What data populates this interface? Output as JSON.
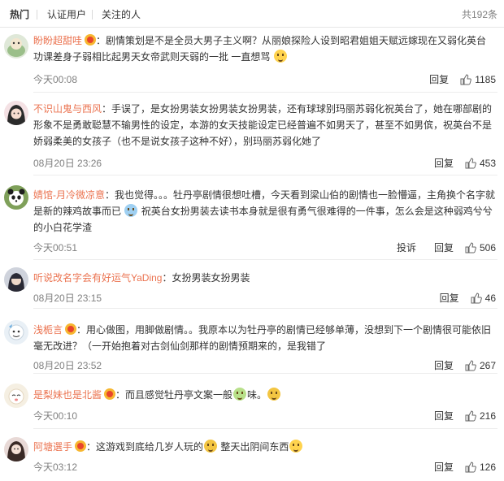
{
  "tabs": {
    "hot": "热门",
    "verified": "认证用户",
    "following": "关注的人"
  },
  "total": "共192条",
  "labels": {
    "reply": "回复",
    "report": "投诉"
  },
  "comments": [
    {
      "user": "盼盼超甜哇",
      "text1": "：剧情策划是不是全员大男子主义啊？从丽娘探险人设到昭君姐姐天赋远嫁现在又弱化英台功课差身子弱相比起男天女帝武则天弱的一批 一直想骂",
      "text2": "",
      "time": "今天00:08",
      "likes": "1185"
    },
    {
      "user": "不识山鬼与西风",
      "text1": "：手误了，是女扮男装女扮男装女扮男装，还有球球别玛丽苏弱化祝英台了，她在哪部剧的形象不是勇敢聪慧不输男性的设定，本游的女天技能设定已经普遍不如男天了，甚至不如男傧，祝英台不是娇弱柔美的女孩子（也不是说女孩子这种不好），别玛丽苏弱化她了",
      "text2": "",
      "time": "08月20日 23:26",
      "likes": "453"
    },
    {
      "user": "婧馆-月冷微凉意",
      "text1": "：我也觉得。。。牡丹亭剧情很想吐槽，今天看到梁山伯的剧情也一脸懵逼，主角换个名字就是新的辣鸡故事而已",
      "text2": "祝英台女扮男装去读书本身就是很有勇气很难得的一件事，怎么会是这种弱鸡兮兮的小白花学渣",
      "time": "今天00:51",
      "likes": "506"
    },
    {
      "user": "听说改名字会有好运气YaDing",
      "text1": "：女扮男装女扮男装",
      "text2": "",
      "time": "08月20日 23:15",
      "likes": "46"
    },
    {
      "user": "浅栀言",
      "text1": "：用心做图，用脚做剧情。。我原本以为牡丹亭的剧情已经够单薄，没想到下一个剧情很可能依旧毫无改进？（一开始抱着对古剑仙剑那样的剧情预期来的，是我错了",
      "text2": "",
      "time": "08月20日 23:52",
      "likes": "267"
    },
    {
      "user": "是梨妹也是北酱",
      "text1": "：而且感觉牡丹亭文案一般",
      "text2": "味。",
      "time": "今天00:10",
      "likes": "216"
    },
    {
      "user": "阿塘選手",
      "text1": "：这游戏到底给几岁人玩的",
      "text2": "整天出阴间东西",
      "time": "今天03:12",
      "likes": "126"
    }
  ],
  "colors": {
    "username": "#eb7350",
    "meta": "#808080",
    "divider": "#ededed"
  }
}
